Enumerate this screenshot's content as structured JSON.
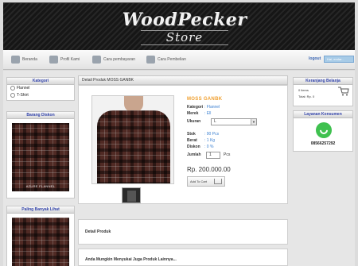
{
  "header": {
    "logo_line1": "WoodPecker",
    "logo_line2": "Store"
  },
  "nav": {
    "items": [
      {
        "label": "Beranda",
        "icon": "home-icon"
      },
      {
        "label": "Profil Kami",
        "icon": "user-icon"
      },
      {
        "label": "Cara pembayaran",
        "icon": "payment-icon"
      },
      {
        "label": "Cara Pembelian",
        "icon": "cart-icon"
      }
    ],
    "logout_label": "logout",
    "login_status": "Hai, endar..."
  },
  "sidebar": {
    "kategori_title": "Kategori",
    "categories": [
      "Flannel",
      "T-Shirt"
    ],
    "diskon_title": "Barang Diskon",
    "diskon_caption": "AZURE FLANNEL",
    "populer_title": "Paling Banyak Lihat"
  },
  "product": {
    "breadcrumb": "Detail Produk MOSS GANBK",
    "name": "MOSS GANBK",
    "kategori_label": "Kategori",
    "kategori_value": ": Flannel",
    "merek_label": "Merek",
    "merek_value": ": Ell",
    "ukuran_label": "Ukuran",
    "ukuran_value": "L",
    "stok_label": "Stok",
    "stok_value": ": 90 Pcs",
    "berat_label": "Berat",
    "berat_value": ": 1 Kg",
    "diskon_label": "Diskon",
    "diskon_value": ": 0 %",
    "jumlah_label": "Jumlah",
    "jumlah_value": "1",
    "jumlah_unit": "Pcs",
    "price": "Rp. 200.000.00",
    "add_to_cart_label": "Add To Cart"
  },
  "detail": {
    "title": "Detail Produk"
  },
  "related": {
    "title": "Anda Mungkin Menyukai Juga Produk Lainnya..."
  },
  "cart": {
    "title": "Keranjang Belanja",
    "items": "0 items",
    "total": "Total: Rp. 0"
  },
  "customer_service": {
    "title": "Layanan Konsumen",
    "phone": "08566257292"
  },
  "colors": {
    "accent_orange": "#f0a030",
    "link_blue": "#3a7fd0",
    "box_title_blue": "#3344aa",
    "whatsapp_green": "#3fc14f"
  }
}
